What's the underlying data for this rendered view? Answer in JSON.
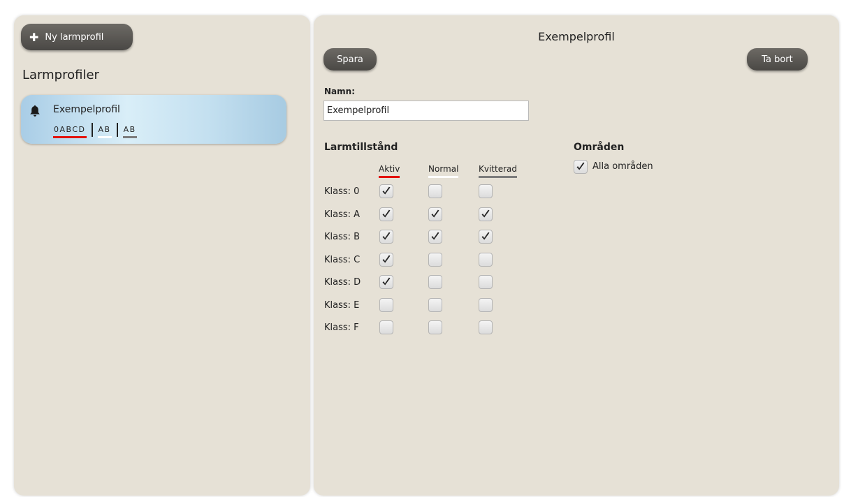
{
  "sidebar": {
    "new_button_label": "Ny larmprofil",
    "list_title": "Larmprofiler",
    "profiles": [
      {
        "name": "Exempelprofil",
        "icon": "bell-icon",
        "tags": {
          "active": "0ABCD",
          "normal": "AB",
          "acknowledged": "AB"
        }
      }
    ]
  },
  "detail": {
    "title": "Exempelprofil",
    "save_label": "Spara",
    "delete_label": "Ta bort",
    "name_label": "Namn:",
    "name_value": "Exempelprofil",
    "states_title": "Larmtillstånd",
    "columns": [
      "Aktiv",
      "Normal",
      "Kvitterad"
    ],
    "classes": [
      {
        "label": "Klass: 0",
        "active": true,
        "normal": false,
        "acknowledged": false
      },
      {
        "label": "Klass: A",
        "active": true,
        "normal": true,
        "acknowledged": true
      },
      {
        "label": "Klass: B",
        "active": true,
        "normal": true,
        "acknowledged": true
      },
      {
        "label": "Klass: C",
        "active": true,
        "normal": false,
        "acknowledged": false
      },
      {
        "label": "Klass: D",
        "active": true,
        "normal": false,
        "acknowledged": false
      },
      {
        "label": "Klass: E",
        "active": false,
        "normal": false,
        "acknowledged": false
      },
      {
        "label": "Klass: F",
        "active": false,
        "normal": false,
        "acknowledged": false
      }
    ],
    "areas_title": "Områden",
    "all_areas_label": "Alla områden",
    "all_areas_checked": true
  },
  "colors": {
    "panel_bg": "#e6e1d6",
    "button_bg": "#5a5855",
    "active_underline": "#e3120b",
    "normal_underline": "#ffffff",
    "acknowledged_underline": "#7c7c7c",
    "selected_item": "#c4e0f0"
  }
}
